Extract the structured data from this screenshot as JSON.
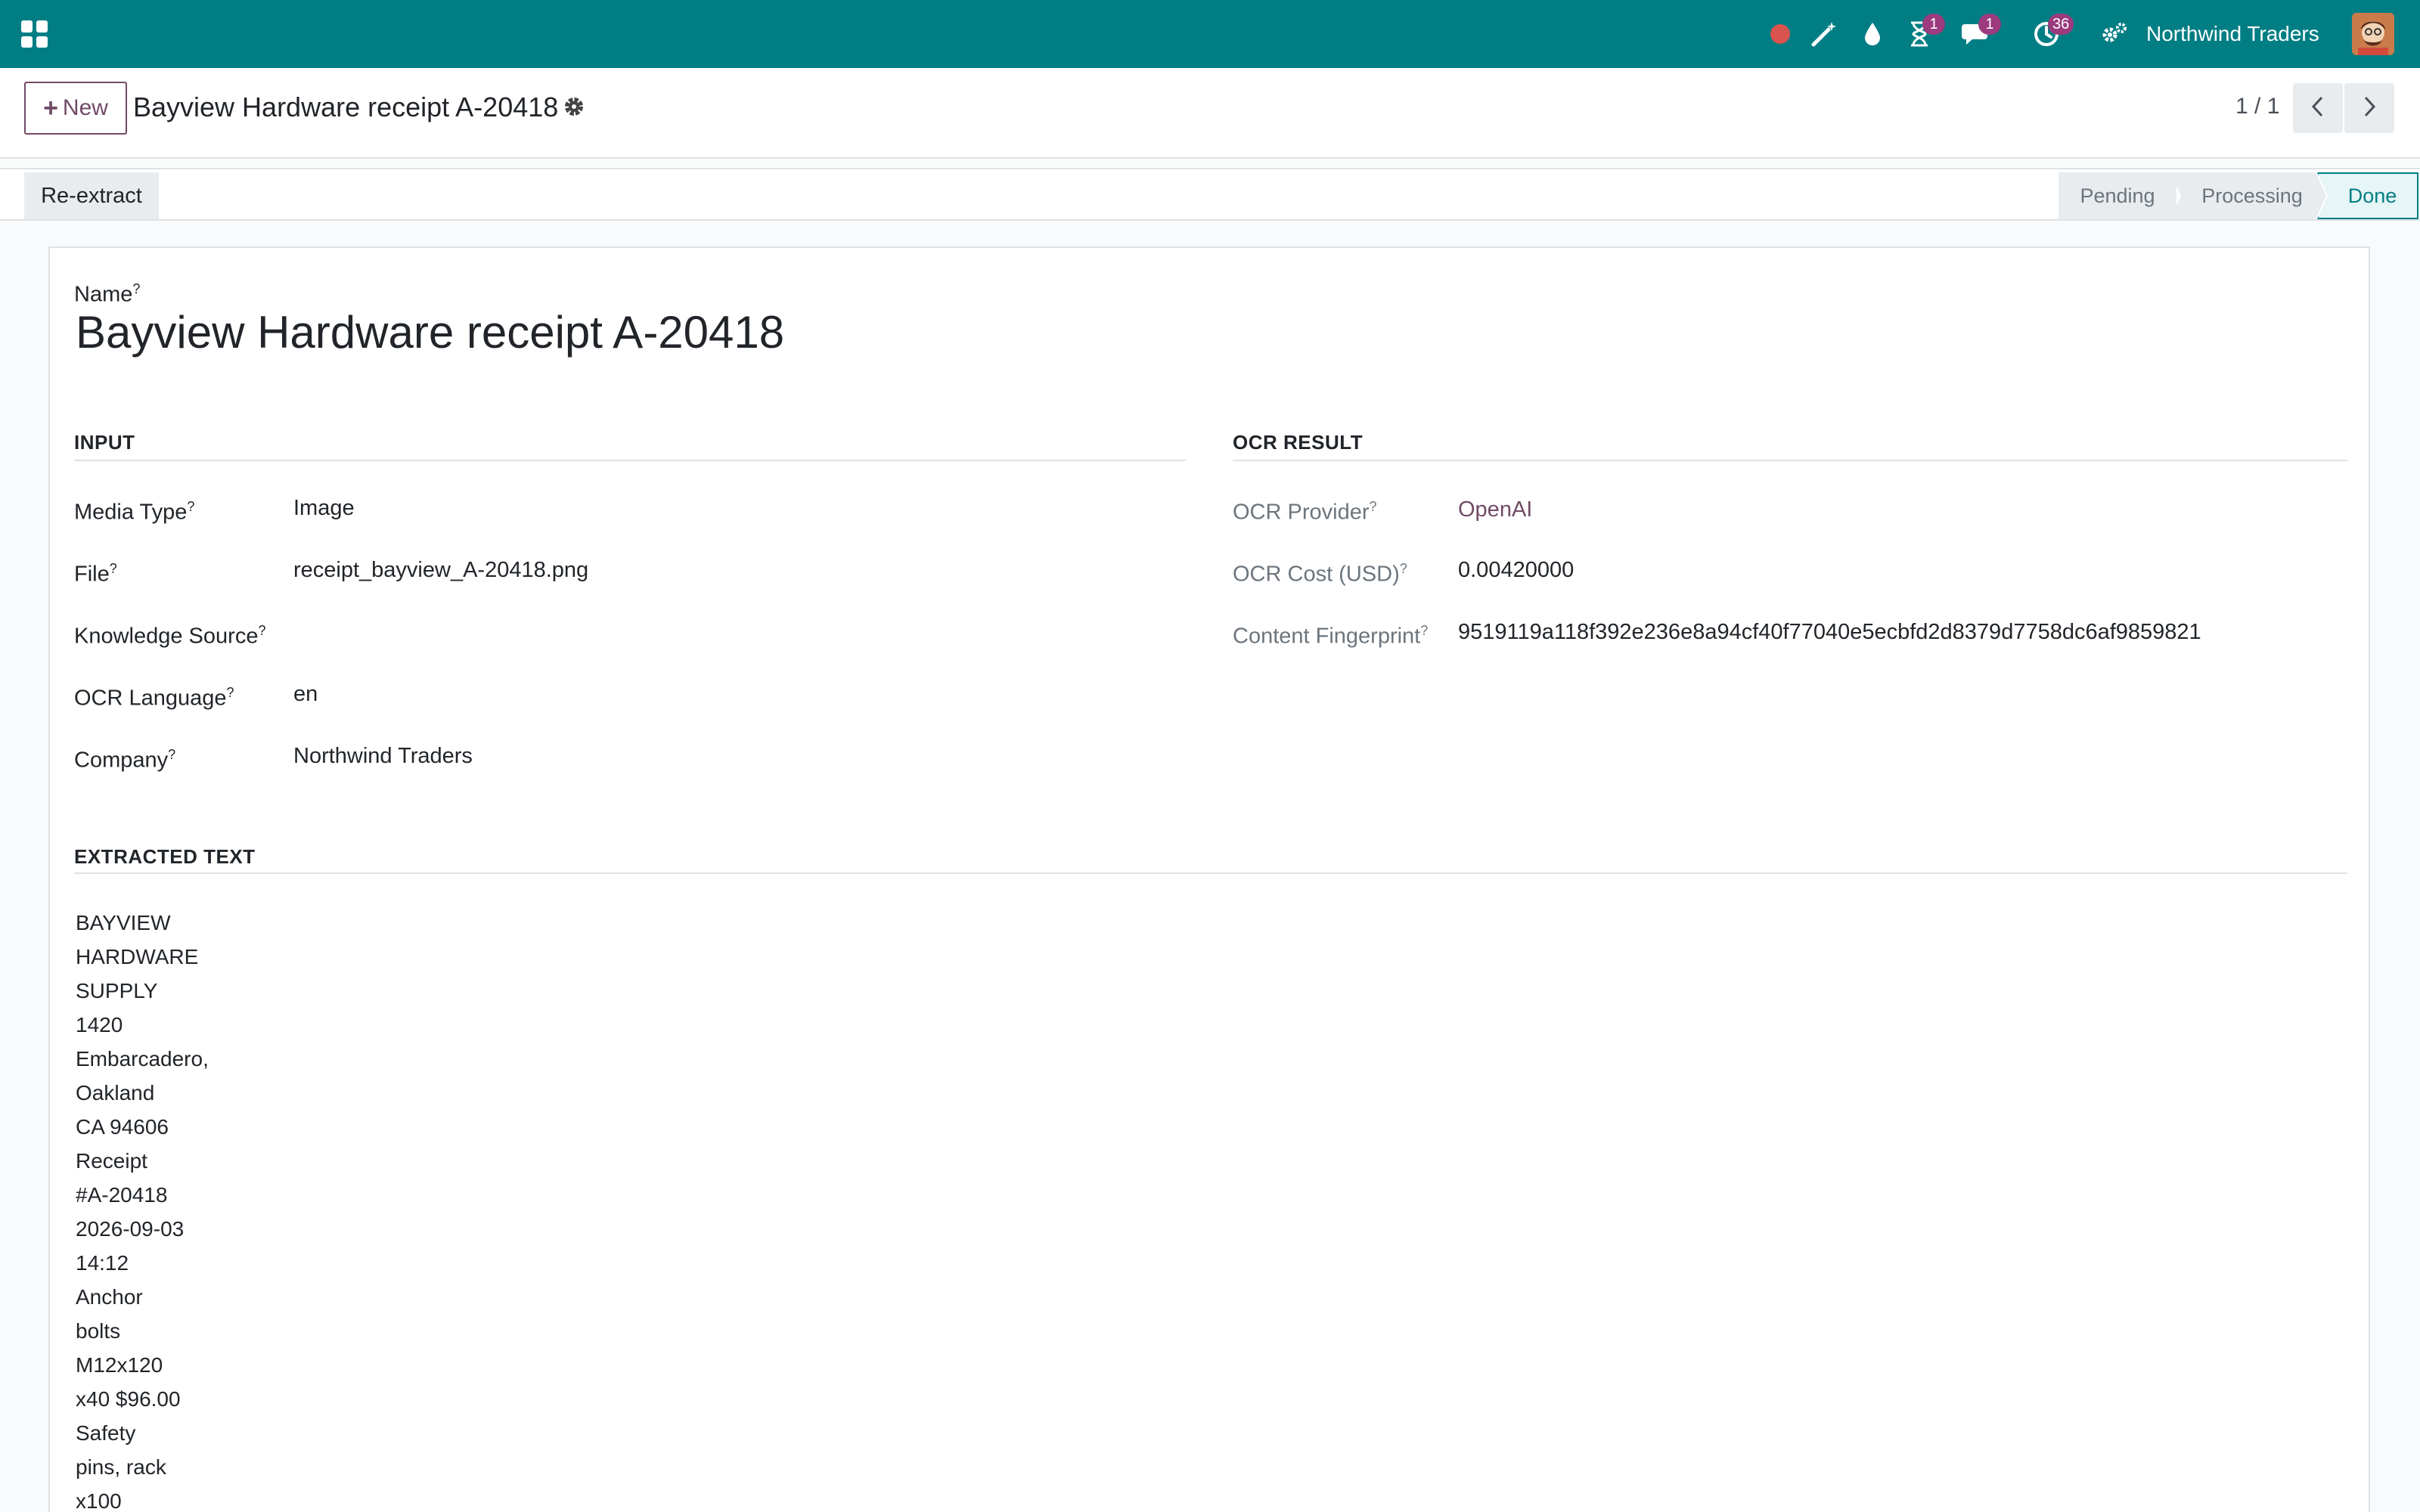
{
  "navbar": {
    "company": "Northwind Traders",
    "badges": {
      "activities": "1",
      "messages": "1",
      "clock": "36"
    }
  },
  "control_panel": {
    "new_label": "New",
    "record_title": "Bayview Hardware receipt A-20418",
    "pager": "1 / 1"
  },
  "statusbar": {
    "reextract_label": "Re-extract",
    "stages": [
      "Pending",
      "Processing",
      "Done"
    ],
    "active_stage": "Done"
  },
  "form": {
    "name_label": "Name",
    "name_value": "Bayview Hardware receipt A-20418",
    "input_section": "INPUT",
    "ocr_section": "OCR RESULT",
    "extracted_section": "EXTRACTED TEXT",
    "input_fields": [
      {
        "label": "Media Type",
        "value": "Image"
      },
      {
        "label": "File",
        "value": "receipt_bayview_A-20418.png"
      },
      {
        "label": "Knowledge Source",
        "value": ""
      },
      {
        "label": "OCR Language",
        "value": "en"
      },
      {
        "label": "Company",
        "value": "Northwind Traders"
      }
    ],
    "ocr_fields": [
      {
        "label": "OCR Provider",
        "value": "OpenAI"
      },
      {
        "label": "OCR Cost (USD)",
        "value": "0.00420000"
      },
      {
        "label": "Content Fingerprint",
        "value": "9519119a118f392e236e8a94cf40f77040e5ecbfd2d8379d7758dc6af9859821"
      }
    ],
    "extracted_lines": [
      "BAYVIEW",
      "HARDWARE",
      "SUPPLY",
      "1420",
      "Embarcadero,",
      "Oakland",
      "CA 94606",
      "Receipt",
      "#A-20418",
      "2026-09-03",
      "14:12",
      "Anchor",
      "bolts",
      "M12x120",
      "x40 $96.00",
      "Safety",
      "pins, rack",
      "x100"
    ]
  },
  "colors": {
    "brand": "#017e84",
    "accent": "#714b67",
    "badge": "#9c3a7e"
  }
}
